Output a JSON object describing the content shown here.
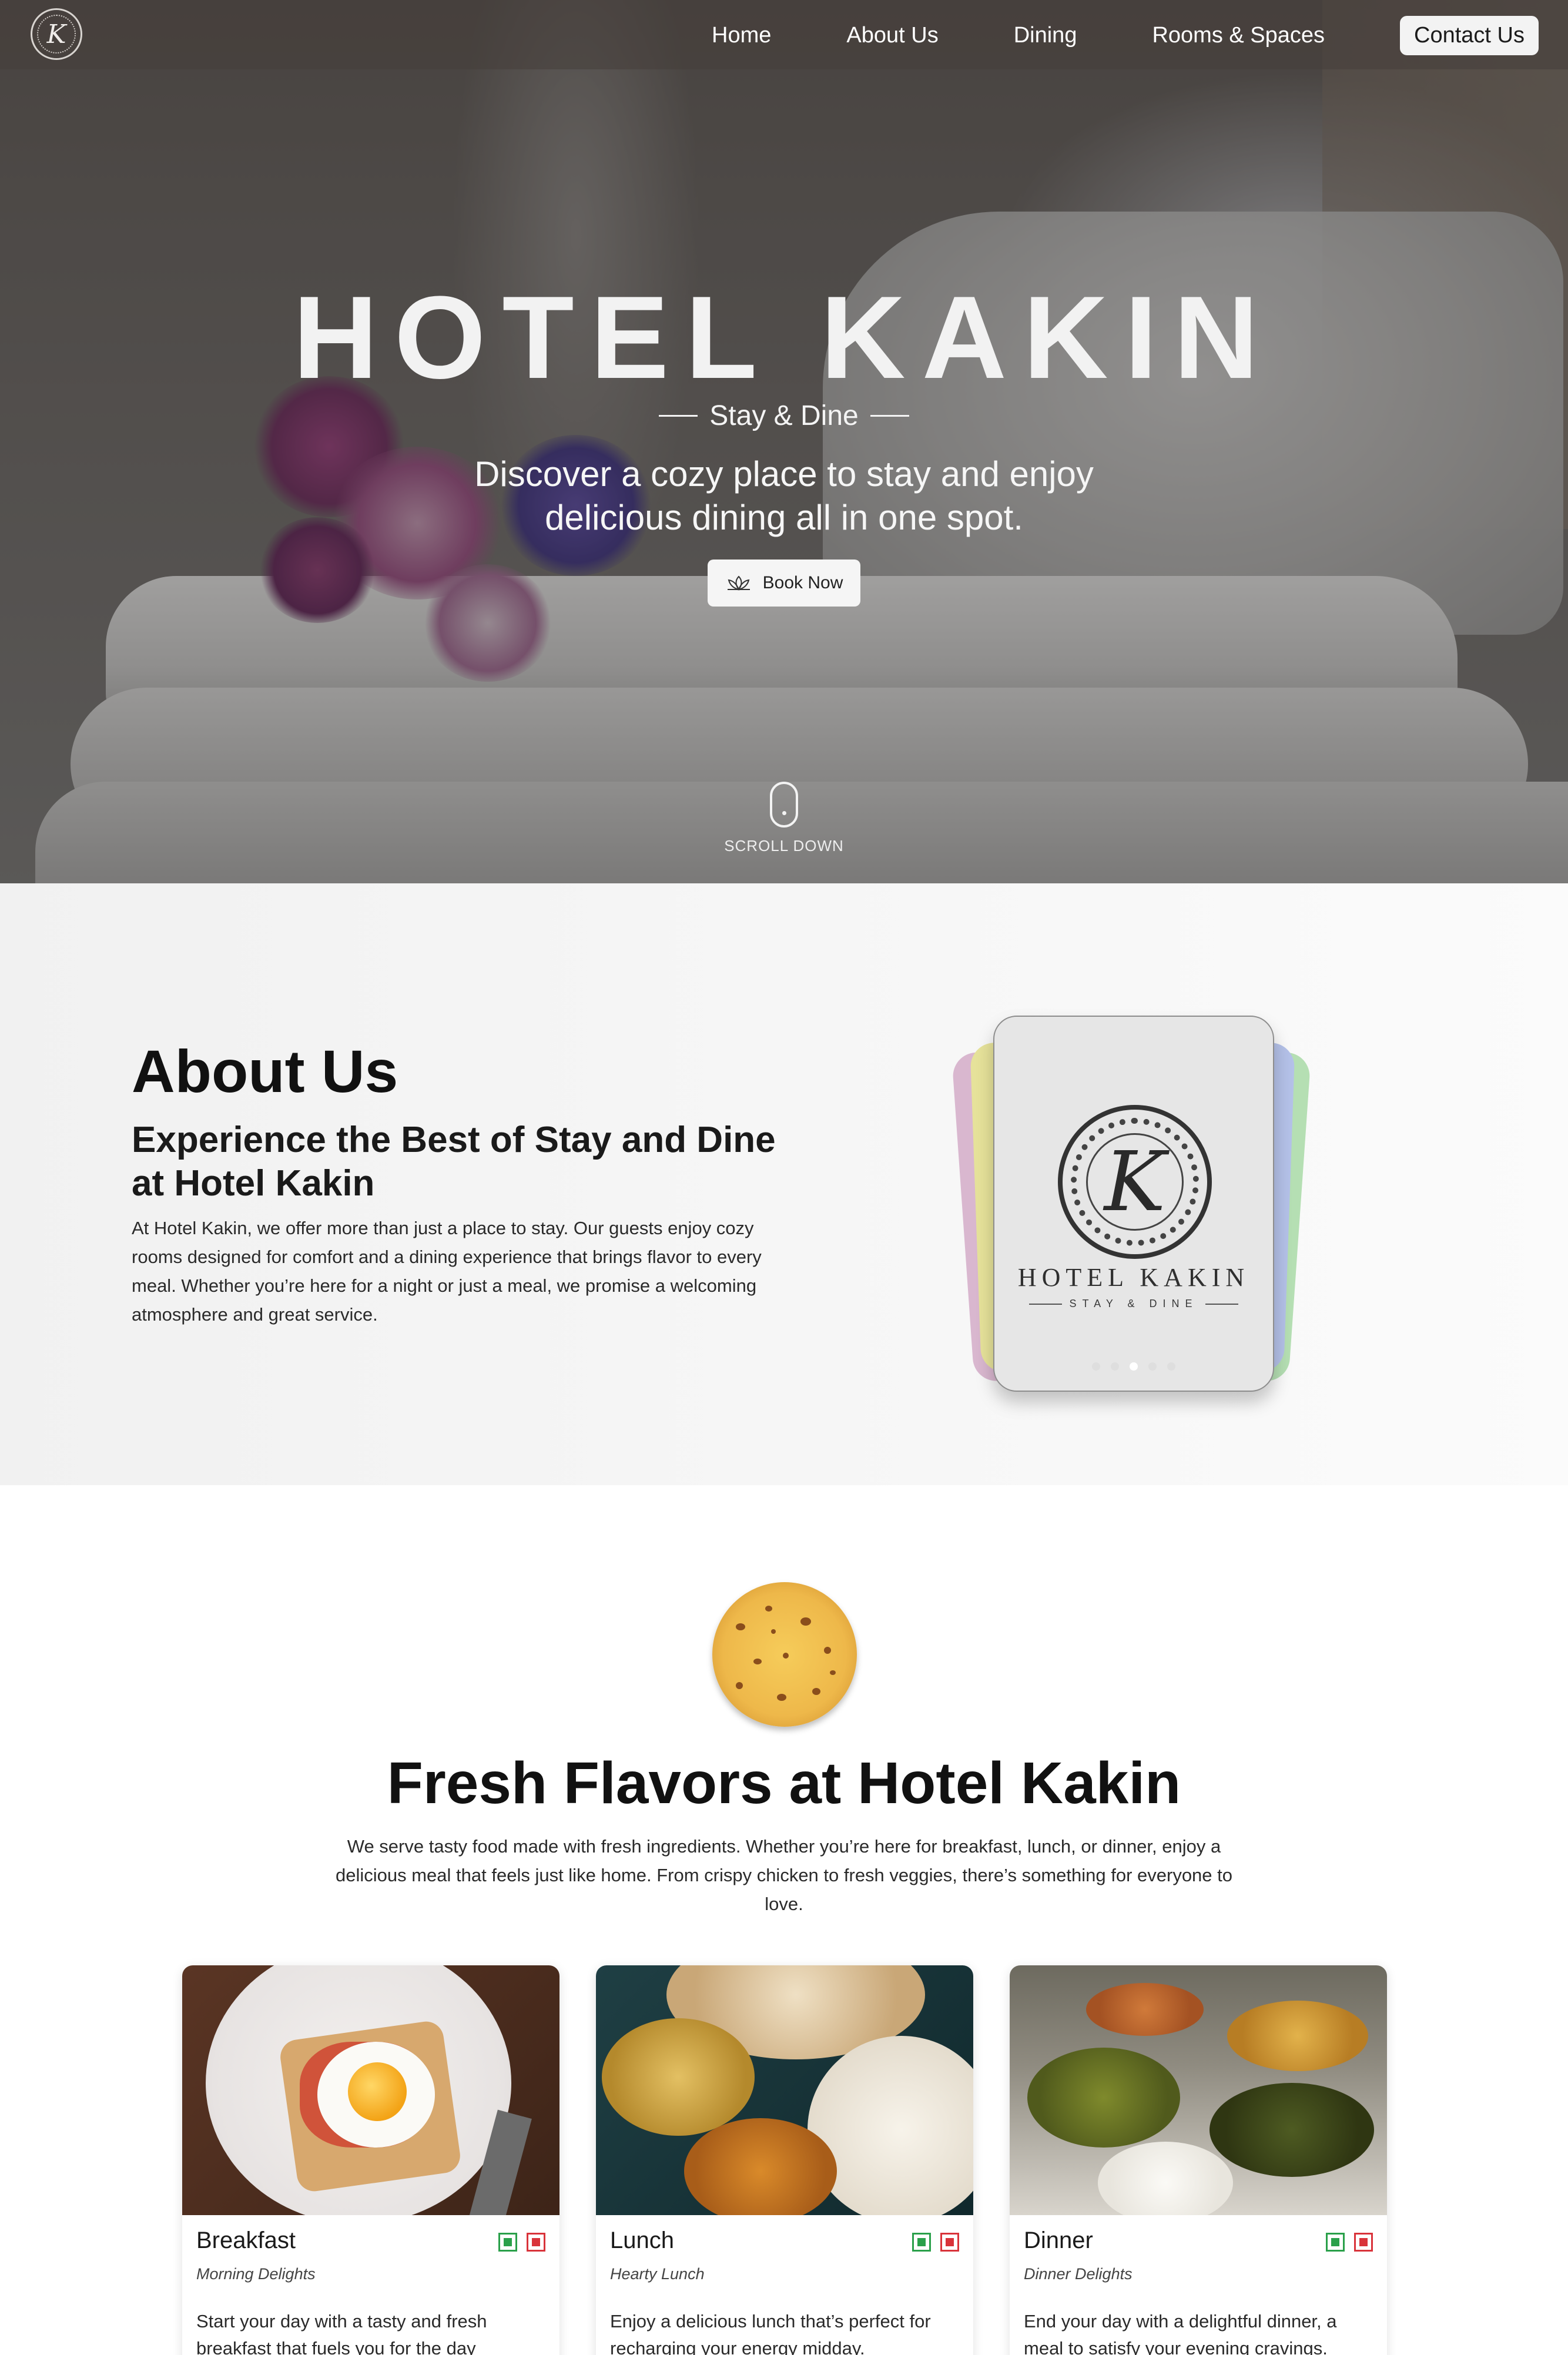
{
  "nav": {
    "logo_letter": "K",
    "links": [
      "Home",
      "About Us",
      "Dining",
      "Rooms & Spaces"
    ],
    "contact": "Contact Us"
  },
  "hero": {
    "title": "HOTEL KAKIN",
    "tagline": "Stay & Dine",
    "subtitle": "Discover a cozy place to stay and enjoy delicious dining all in one spot.",
    "book_button": "Book Now",
    "scroll_label": "SCROLL DOWN"
  },
  "about": {
    "heading": "About Us",
    "subheading": "Experience the Best of Stay and Dine at Hotel Kakin",
    "body": "At Hotel Kakin, we offer more than just a place to stay. Our guests enjoy cozy rooms designed for comfort and a dining experience that brings flavor to every meal. Whether you’re here for a night or just a meal, we promise a welcoming atmosphere and great service.",
    "card": {
      "seal_letter": "K",
      "name": "HOTEL KAKIN",
      "tagline": "STAY & DINE",
      "slide_count": 5,
      "active_slide": 3
    }
  },
  "dining": {
    "title": "Fresh Flavors at Hotel Kakin",
    "description": "We serve tasty food made with fresh ingredients. Whether you’re here for breakfast, lunch, or dinner, enjoy a delicious meal that feels just like home. From crispy chicken to fresh veggies, there’s something for everyone to love.",
    "cards": [
      {
        "name": "Breakfast",
        "tag": "Morning Delights",
        "desc": "Start your day with a tasty and fresh breakfast that fuels you for the day"
      },
      {
        "name": "Lunch",
        "tag": "Hearty Lunch",
        "desc": "Enjoy a delicious lunch that’s perfect for recharging your energy midday."
      },
      {
        "name": "Dinner",
        "tag": "Dinner Delights",
        "desc": "End your day with a delightful dinner, a meal to satisfy your evening cravings."
      }
    ],
    "veg_color": "#2aa04a",
    "nonveg_color": "#d9333a"
  }
}
